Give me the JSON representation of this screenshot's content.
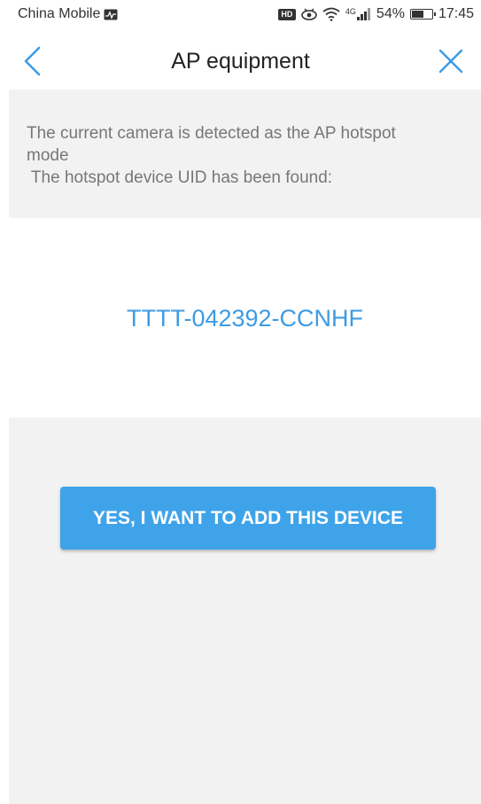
{
  "status_bar": {
    "carrier": "China Mobile",
    "battery": "54%",
    "time": "17:45",
    "network": "4G",
    "icons": [
      "activity-icon",
      "hd-icon",
      "eye-icon",
      "wifi-icon",
      "signal-icon",
      "battery-icon"
    ]
  },
  "nav": {
    "title": "AP equipment",
    "back_icon": "chevron-left-icon",
    "close_icon": "close-icon",
    "accent_color": "#3d9be3"
  },
  "info": {
    "line1": "The current camera is detected as the AP hotspot",
    "line2": "mode",
    "line3": " The hotspot device UID has been found:"
  },
  "device": {
    "uid": "TTTT-042392-CCNHF"
  },
  "actions": {
    "add_button_label": "YES, I WANT TO ADD THIS DEVICE",
    "button_color": "#3fa3ea"
  }
}
